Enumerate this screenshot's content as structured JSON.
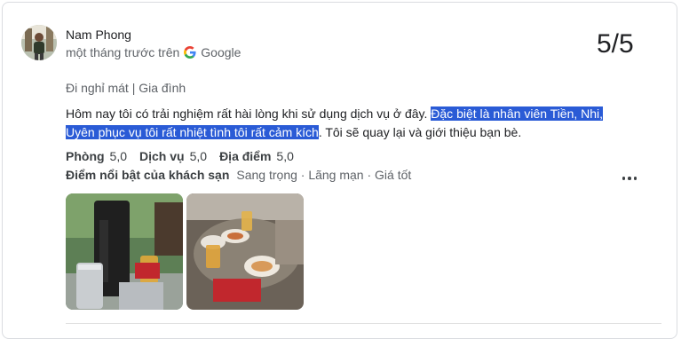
{
  "reviewer": {
    "name": "Nam Phong",
    "time": "một tháng trước trên",
    "source": "Google"
  },
  "score": "5/5",
  "trip_type": "Đi nghỉ mát | Gia đình",
  "review": {
    "part1": "Hôm nay tôi có trải nghiệm rất hài lòng khi sử dụng dịch vụ ở đây. ",
    "highlighted": "Đặc biệt là nhân viên Tiền, Nhi, Uyên phục vụ tôi rất nhiệt tình tôi rất cảm kích",
    "part2": ". Tôi sẽ quay lại và giới thiệu bạn bè."
  },
  "ratings": [
    {
      "label": "Phòng",
      "value": "5,0"
    },
    {
      "label": "Dịch vụ",
      "value": "5,0"
    },
    {
      "label": "Địa điểm",
      "value": "5,0"
    }
  ],
  "hotel_highlights": {
    "label": "Điểm nổi bật của khách sạn",
    "value": "Sang trọng · Lãng mạn · Giá tốt"
  },
  "colors": {
    "selection": "#2a5bd6",
    "muted": "#5f6368"
  }
}
